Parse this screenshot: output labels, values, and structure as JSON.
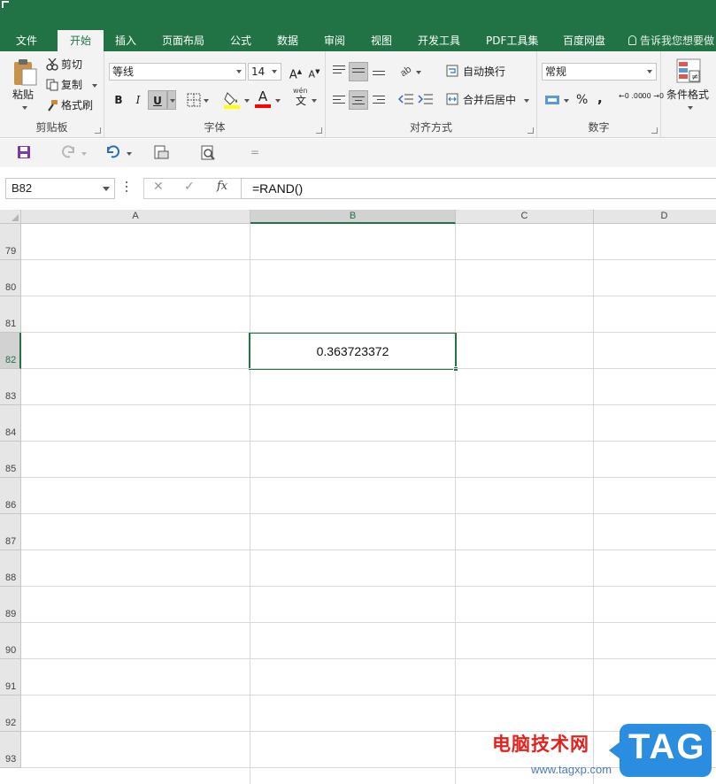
{
  "ribbon_tabs": [
    {
      "label": "文件",
      "active": false
    },
    {
      "label": "开始",
      "active": true
    },
    {
      "label": "插入",
      "active": false
    },
    {
      "label": "页面布局",
      "active": false
    },
    {
      "label": "公式",
      "active": false
    },
    {
      "label": "数据",
      "active": false
    },
    {
      "label": "审阅",
      "active": false
    },
    {
      "label": "视图",
      "active": false
    },
    {
      "label": "开发工具",
      "active": false
    },
    {
      "label": "PDF工具集",
      "active": false
    },
    {
      "label": "百度网盘",
      "active": false
    }
  ],
  "tell_me": "告诉我您想要做",
  "clipboard": {
    "paste": "粘贴",
    "cut": "剪切",
    "copy": "复制",
    "format_painter": "格式刷",
    "group_label": "剪贴板"
  },
  "font": {
    "name": "等线",
    "size": "14",
    "bold": "B",
    "italic": "I",
    "underline": "U",
    "grow": "A",
    "shrink": "A",
    "color_letter": "A",
    "phonetic_top": "wén",
    "phonetic_char": "文",
    "group_label": "字体",
    "fill_color": "#ffff00",
    "font_color": "#ff0000"
  },
  "alignment": {
    "wrap_text": "自动换行",
    "merge_center": "合并后居中",
    "group_label": "对齐方式"
  },
  "number": {
    "format": "常规",
    "percent": "%",
    "comma": ",",
    "increase_decimal": "←0 .00",
    "decrease_decimal": ".00 →0",
    "group_label": "数字"
  },
  "styles": {
    "conditional_format": "条件格式"
  },
  "formula_bar": {
    "name_box": "B82",
    "cancel": "✕",
    "enter": "✓",
    "fx": "fx",
    "formula": "=RAND()"
  },
  "grid": {
    "columns": [
      "A",
      "B",
      "C",
      "D"
    ],
    "selected_column": "B",
    "rows": [
      "79",
      "80",
      "81",
      "82",
      "83",
      "84",
      "85",
      "86",
      "87",
      "88",
      "89",
      "90",
      "91",
      "92",
      "93"
    ],
    "selected_row": "82",
    "active_cell_value": "0.363723372"
  },
  "watermark": {
    "text": "电脑技术网",
    "url": "www.tagxp.com",
    "tag": "TAG"
  },
  "colors": {
    "excel_green": "#217346",
    "ribbon_bg": "#f3f3f3",
    "header_bg": "#e6e6e6",
    "gridline": "#d9d9d9"
  }
}
